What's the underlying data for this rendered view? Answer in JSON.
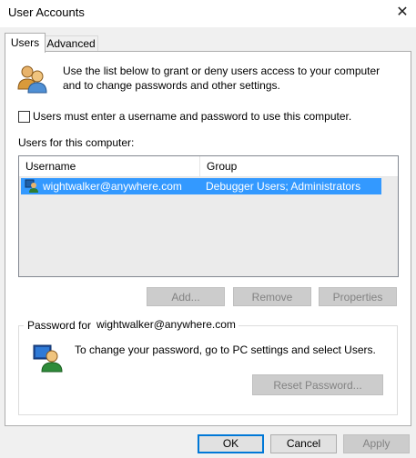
{
  "window": {
    "title": "User Accounts",
    "close_glyph": "✕"
  },
  "tabs": [
    {
      "label": "Users"
    },
    {
      "label": "Advanced"
    }
  ],
  "intro": {
    "text": "Use the list below to grant or deny users access to your computer and to change passwords and other settings."
  },
  "require_login": {
    "label": "Users must enter a username and password to use this computer.",
    "checked": false
  },
  "users_section": {
    "label": "Users for this computer:"
  },
  "users_table": {
    "columns": [
      "Username",
      "Group"
    ],
    "rows": [
      {
        "username": "wightwalker@anywhere.com",
        "group": "Debugger Users; Administrators",
        "selected": true
      }
    ]
  },
  "user_buttons": {
    "add": "Add...",
    "remove": "Remove",
    "properties": "Properties"
  },
  "password_group": {
    "legend": "Password for",
    "username": "wightwalker@anywhere.com",
    "text": "To change your password, go to PC settings and select Users.",
    "reset_button": "Reset Password..."
  },
  "footer": {
    "ok": "OK",
    "cancel": "Cancel",
    "apply": "Apply"
  },
  "colors": {
    "selection": "#3399ff",
    "accent_border": "#0078d7"
  }
}
